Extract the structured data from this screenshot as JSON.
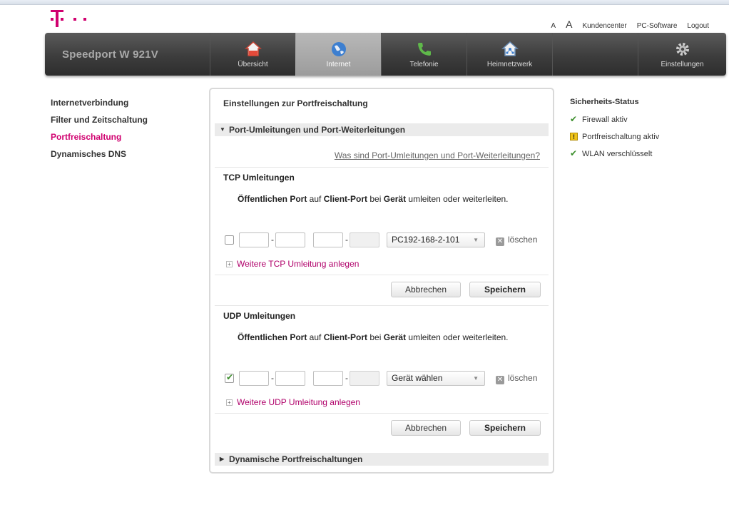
{
  "toplinks": {
    "a_small": "A",
    "a_big": "A",
    "kundencenter": "Kundencenter",
    "pc_software": "PC-Software",
    "logout": "Logout"
  },
  "brand": "Speedport W 921V",
  "nav": [
    {
      "label": "Übersicht",
      "icon": "house-icon"
    },
    {
      "label": "Internet",
      "icon": "globe-icon"
    },
    {
      "label": "Telefonie",
      "icon": "phone-icon"
    },
    {
      "label": "Heimnetzwerk",
      "icon": "home-network-icon"
    },
    {
      "label": "",
      "icon": ""
    },
    {
      "label": "Einstellungen",
      "icon": "gear-icon"
    }
  ],
  "leftnav": [
    "Internetverbindung",
    "Filter und Zeitschaltung",
    "Portfreischaltung",
    "Dynamisches DNS"
  ],
  "panel": {
    "title": "Einstellungen zur Portfreischaltung",
    "section1": "Port-Umleitungen und Port-Weiterleitungen",
    "helplink": "Was sind Port-Umleitungen und Port-Weiterleitungen?",
    "desc": {
      "public_port": "Öffentlichen Port",
      "auf": " auf ",
      "client_port": "Client-Port",
      "bei": " bei ",
      "device": "Gerät",
      "rest": " umleiten oder weiterleiten."
    },
    "tcp": {
      "heading": "TCP Umleitungen",
      "select_value": "PC192-168-2-101",
      "delete": "löschen",
      "add": "Weitere TCP Umleitung anlegen",
      "cancel": "Abbrechen",
      "save": "Speichern"
    },
    "udp": {
      "heading": "UDP Umleitungen",
      "select_value": "Gerät wählen",
      "delete": "löschen",
      "add": "Weitere UDP Umleitung anlegen",
      "cancel": "Abbrechen",
      "save": "Speichern"
    },
    "section2": "Dynamische Portfreischaltungen"
  },
  "status": {
    "heading": "Sicherheits-Status",
    "items": [
      "Firewall aktiv",
      "Portfreischaltung aktiv",
      "WLAN verschlüsselt"
    ]
  },
  "colors": {
    "magenta": "#d0006f",
    "ok_green": "#3b8e2b",
    "warn_yellow": "#f0c419"
  }
}
